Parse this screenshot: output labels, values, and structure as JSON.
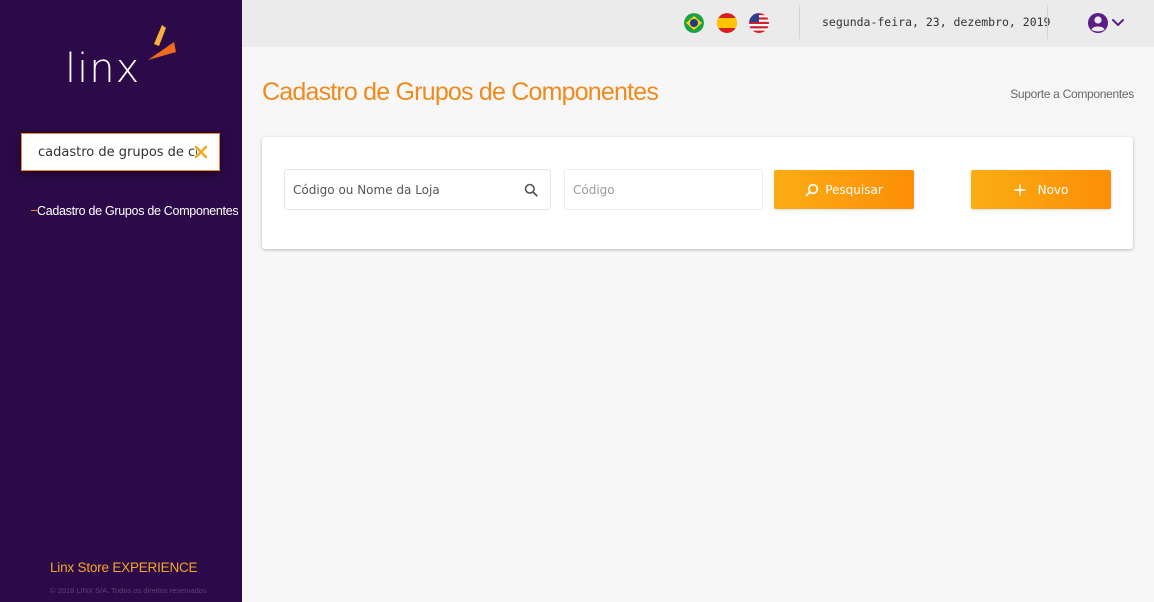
{
  "sidebar": {
    "logo_text": "linx",
    "search": {
      "value": "cadastro de grupos de com"
    },
    "items": [
      {
        "label": "Cadastro de Grupos de Componentes"
      }
    ],
    "brand": "Linx Store EXPERIENCE",
    "copyright": "© 2018 LINX S/A. Todos os direitos reservados"
  },
  "topbar": {
    "languages": [
      {
        "icon": "flag-brazil-icon"
      },
      {
        "icon": "flag-spain-icon"
      },
      {
        "icon": "flag-usa-icon"
      }
    ],
    "date": "segunda-feira, 23, dezembro, 2019",
    "user_icon": "user-circle-icon"
  },
  "main": {
    "title": "Cadastro de Grupos de Componentes",
    "support_link": "Suporte a Componentes",
    "filters": {
      "store_placeholder": "Código ou Nome da Loja",
      "code_placeholder": "Código"
    },
    "buttons": {
      "search_label": "Pesquisar",
      "new_label": "Novo"
    }
  },
  "colors": {
    "sidebar_bg": "#2c0a4a",
    "accent": "#f08a1c",
    "button_gradient_start": "#fbad14",
    "button_gradient_end": "#fd8e06",
    "page_bg": "#f7f7f7",
    "topbar_bg": "#ebebeb",
    "user_icon": "#5b1e84"
  }
}
